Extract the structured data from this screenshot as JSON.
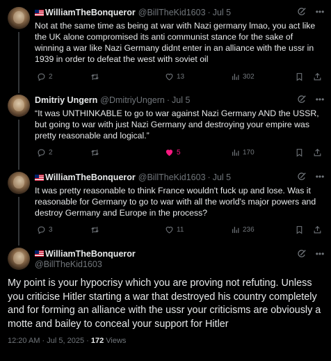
{
  "tweets": [
    {
      "name": "WilliamTheBonqueror",
      "handle": "@BillTheKid1603",
      "date": "Jul 5",
      "text": "Not at the same time as being at war with Nazi germany lmao, you act like the UK alone compromised its anti communist stance for the sake of winning a war like Nazi Germany didnt enter in an alliance with the ussr in 1939 in order to defeat the west with soviet oil",
      "replies": "2",
      "reposts": "",
      "likes": "13",
      "views": "302"
    },
    {
      "name": "Dmitriy Ungern",
      "handle": "@DmitriyUngern",
      "date": "Jul 5",
      "text": "“It was UNTHINKABLE to go to war against Nazi Germany AND the USSR, but going to war with just Nazi Germany and destroying your empire was pretty reasonable and logical.”",
      "replies": "2",
      "reposts": "",
      "likes": "5",
      "views": "170"
    },
    {
      "name": "WilliamTheBonqueror",
      "handle": "@BillTheKid1603",
      "date": "Jul 5",
      "text": "It was pretty reasonable to think France wouldn't fuck up and lose. Was it reasonable for Germany to go to war with all the world's major powers and destroy Germany and Europe in the process?",
      "replies": "3",
      "reposts": "",
      "likes": "11",
      "views": "236"
    }
  ],
  "main": {
    "name": "WilliamTheBonqueror",
    "handle": "@BillTheKid1603",
    "text": "My point is your hypocrisy which you are proving not refuting. Unless you criticise Hitler starting a war that destroyed his country completely and for forming an alliance with the ussr your criticisms are obviously a motte and bailey to conceal your support for Hitler",
    "time": "12:20 AM · Jul 5, 2025 · ",
    "views": "172",
    "views_label": " Views"
  },
  "icons": {
    "reply": "reply-icon",
    "repost": "repost-icon",
    "like": "heart-icon",
    "views": "views-chart-icon",
    "bookmark": "bookmark-icon",
    "share": "share-icon",
    "grok": "grok-icon",
    "more": "more-dots-icon",
    "flag": "uk-flag-icon"
  },
  "colors": {
    "background": "#000000",
    "text": "#e7e9ea",
    "muted": "#71767b",
    "like_active": "#f91880",
    "divider": "#2f3336"
  }
}
